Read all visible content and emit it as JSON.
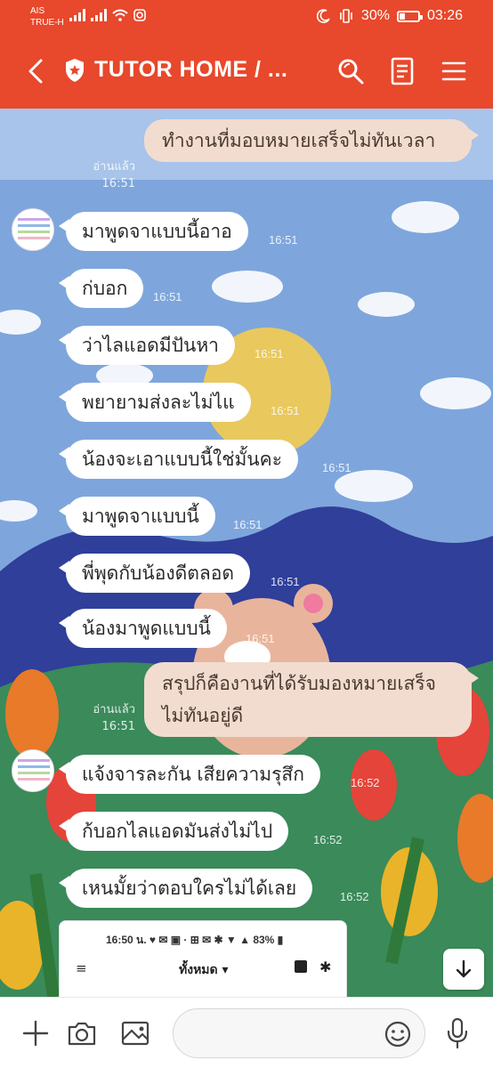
{
  "status_bar": {
    "carrier_line1": "AIS",
    "carrier_line2": "TRUE-H",
    "battery": "30%",
    "battery_level": 0.3,
    "time": "03:26"
  },
  "header": {
    "title": "TUTOR HOME / ...",
    "accent_color": "#e8482b",
    "icons": [
      "back-arrow-icon",
      "shield-star-icon",
      "search-icon",
      "notes-icon",
      "menu-icon"
    ]
  },
  "messages": [
    {
      "dir": "out",
      "text": "ทำงานที่มอบหมายเสร็จไม่ทันเวลา",
      "read": "อ่านแล้ว",
      "time": "16:51"
    },
    {
      "dir": "in",
      "text": "มาพูดจาแบบนี้อาอ",
      "time": "16:51"
    },
    {
      "dir": "in",
      "text": "ก่บอก",
      "time": "16:51"
    },
    {
      "dir": "in",
      "text": "ว่าไลแอดมีปันหา",
      "time": "16:51"
    },
    {
      "dir": "in",
      "text": "พยายามส่งละไม่ไแ",
      "time": "16:51"
    },
    {
      "dir": "in",
      "text": "น้องจะเอาแบบนี้ใช่มั้นคะ",
      "time": "16:51"
    },
    {
      "dir": "in",
      "text": "มาพูดจาแบบนี้",
      "time": "16:51"
    },
    {
      "dir": "in",
      "text": "พี่พุดกับน้องดีตลอด",
      "time": "16:51"
    },
    {
      "dir": "in",
      "text": "น้องมาพูดแบบนี้",
      "time": "16:51"
    },
    {
      "dir": "out",
      "text": "สรุปก็คืองานที่ได้รับมองหมายเสร็จไม่ทันอยู่ดี",
      "read": "อ่านแล้ว",
      "time": "16:51"
    },
    {
      "dir": "in",
      "text": "แจ้งจารละกัน เสียความรุสึก",
      "time": "16:52"
    },
    {
      "dir": "in",
      "text": "ก้บอกไลแอดมันส่งไม่ไป",
      "time": "16:52"
    },
    {
      "dir": "in",
      "text": "เหนมั้ยว่าตอบใครไม่ได้เลย",
      "time": "16:52"
    }
  ],
  "shared_screenshot": {
    "status": "16:50 น. ♥ ✉ ▣ · ⊞ ✉ ✱ ▼ ▲ 83% ▮",
    "menu": "≡",
    "tab": "ทั้งหมด ▾"
  },
  "input": {
    "placeholder": "",
    "icons": [
      "plus-icon",
      "camera-icon",
      "image-icon",
      "emoji-icon",
      "microphone-icon"
    ]
  }
}
